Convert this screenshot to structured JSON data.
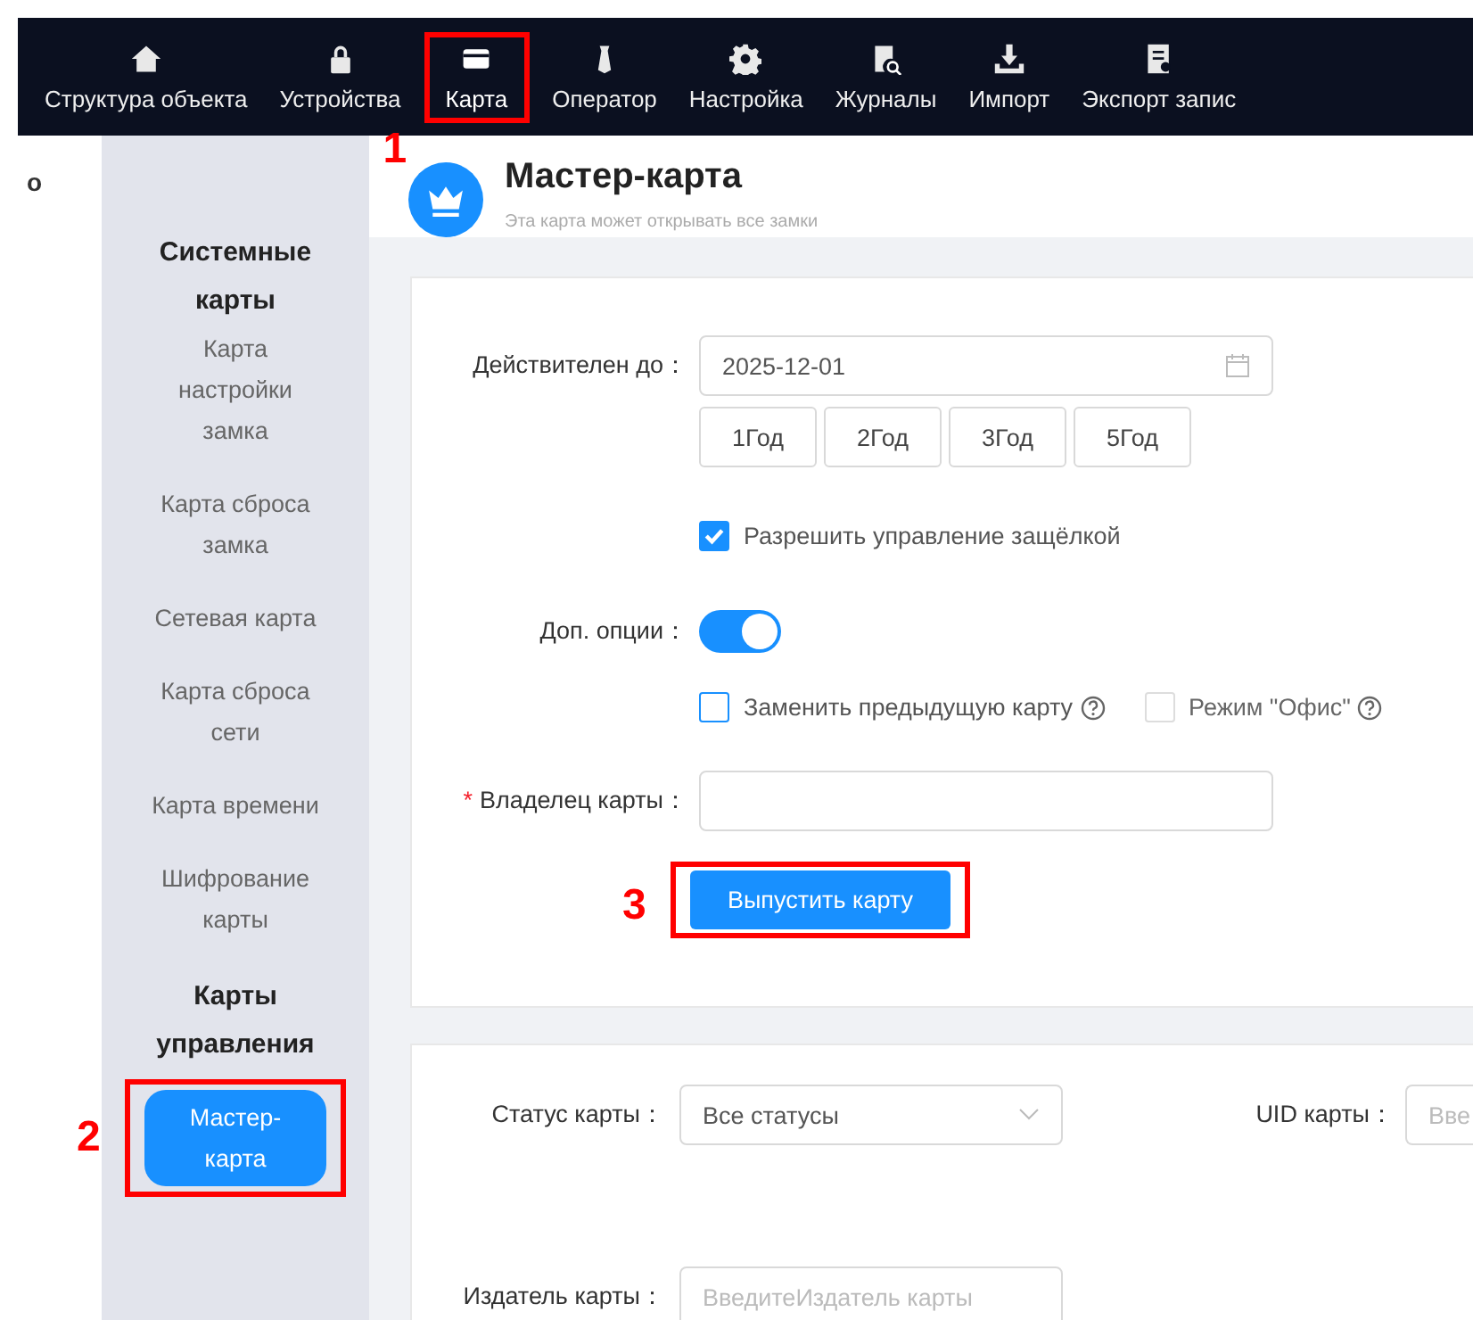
{
  "edge_text": "о",
  "nav": [
    {
      "label": "Структура объекта",
      "selected": false
    },
    {
      "label": "Устройства",
      "selected": false
    },
    {
      "label": "Карта",
      "selected": true,
      "annotation": "1"
    },
    {
      "label": "Оператор",
      "selected": false
    },
    {
      "label": "Настройка",
      "selected": false
    },
    {
      "label": "Журналы",
      "selected": false
    },
    {
      "label": "Импорт",
      "selected": false
    },
    {
      "label": "Экспорт запис",
      "selected": false
    }
  ],
  "sidebar": [
    {
      "kind": "heading",
      "label": "Системные карты"
    },
    {
      "kind": "item",
      "label": "Карта настройки замка",
      "selected": false
    },
    {
      "kind": "item",
      "label": "Карта сброса замка",
      "selected": false
    },
    {
      "kind": "item",
      "label": "Сетевая карта",
      "selected": false
    },
    {
      "kind": "item",
      "label": "Карта сброса сети",
      "selected": false
    },
    {
      "kind": "item",
      "label": "Карта времени",
      "selected": false
    },
    {
      "kind": "item",
      "label": "Шифрование карты",
      "selected": false
    },
    {
      "kind": "heading",
      "label": "Карты управления"
    },
    {
      "kind": "item",
      "label": "Мастер-карта",
      "selected": true,
      "annotation": "2"
    }
  ],
  "header": {
    "title": "Мастер-карта",
    "subtitle": "Эта карта может открывать все замки"
  },
  "form": {
    "valid_label": "Действителен до：",
    "valid_value": "2025-12-01",
    "year_buttons": [
      "1Год",
      "2Год",
      "3Год",
      "5Год"
    ],
    "latch": {
      "label": "Разрешить управление защёлкой",
      "checked": true
    },
    "options_label": "Доп. опции：",
    "options_on": true,
    "extra": [
      {
        "label": "Заменить предыдущую карту",
        "checked": false,
        "disabled": false
      },
      {
        "label": "Режим \"Офис\"",
        "checked": false,
        "disabled": true
      }
    ],
    "owner_required_mark": "*",
    "owner_label": "Владелец карты：",
    "submit": "Выпустить карту",
    "submit_annotation": "3"
  },
  "filters": {
    "status_label": "Статус карты：",
    "status_value": "Все статусы",
    "uid_label": "UID карты：",
    "uid_placeholder": "Вве",
    "issuer_label": "Издатель карты：",
    "issuer_placeholder": "ВведитеИздатель карты"
  }
}
